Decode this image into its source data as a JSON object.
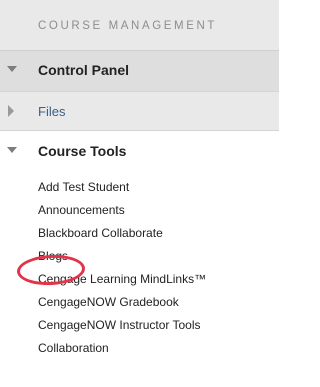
{
  "header": {
    "title": "COURSE MANAGEMENT"
  },
  "control_panel": {
    "label": "Control Panel",
    "icon": "triangle-down-icon"
  },
  "files": {
    "label": "Files",
    "icon": "triangle-right-icon"
  },
  "course_tools": {
    "label": "Course Tools",
    "icon": "triangle-down-icon",
    "items": [
      {
        "label": "Add Test Student"
      },
      {
        "label": "Announcements"
      },
      {
        "label": "Blackboard Collaborate"
      },
      {
        "label": "Blogs"
      },
      {
        "label": "Cengage Learning MindLinks™"
      },
      {
        "label": "CengageNOW Gradebook"
      },
      {
        "label": "CengageNOW Instructor Tools"
      },
      {
        "label": "Collaboration"
      }
    ]
  },
  "annotation": {
    "highlighted_item": "Blogs",
    "color": "#e2334a"
  }
}
